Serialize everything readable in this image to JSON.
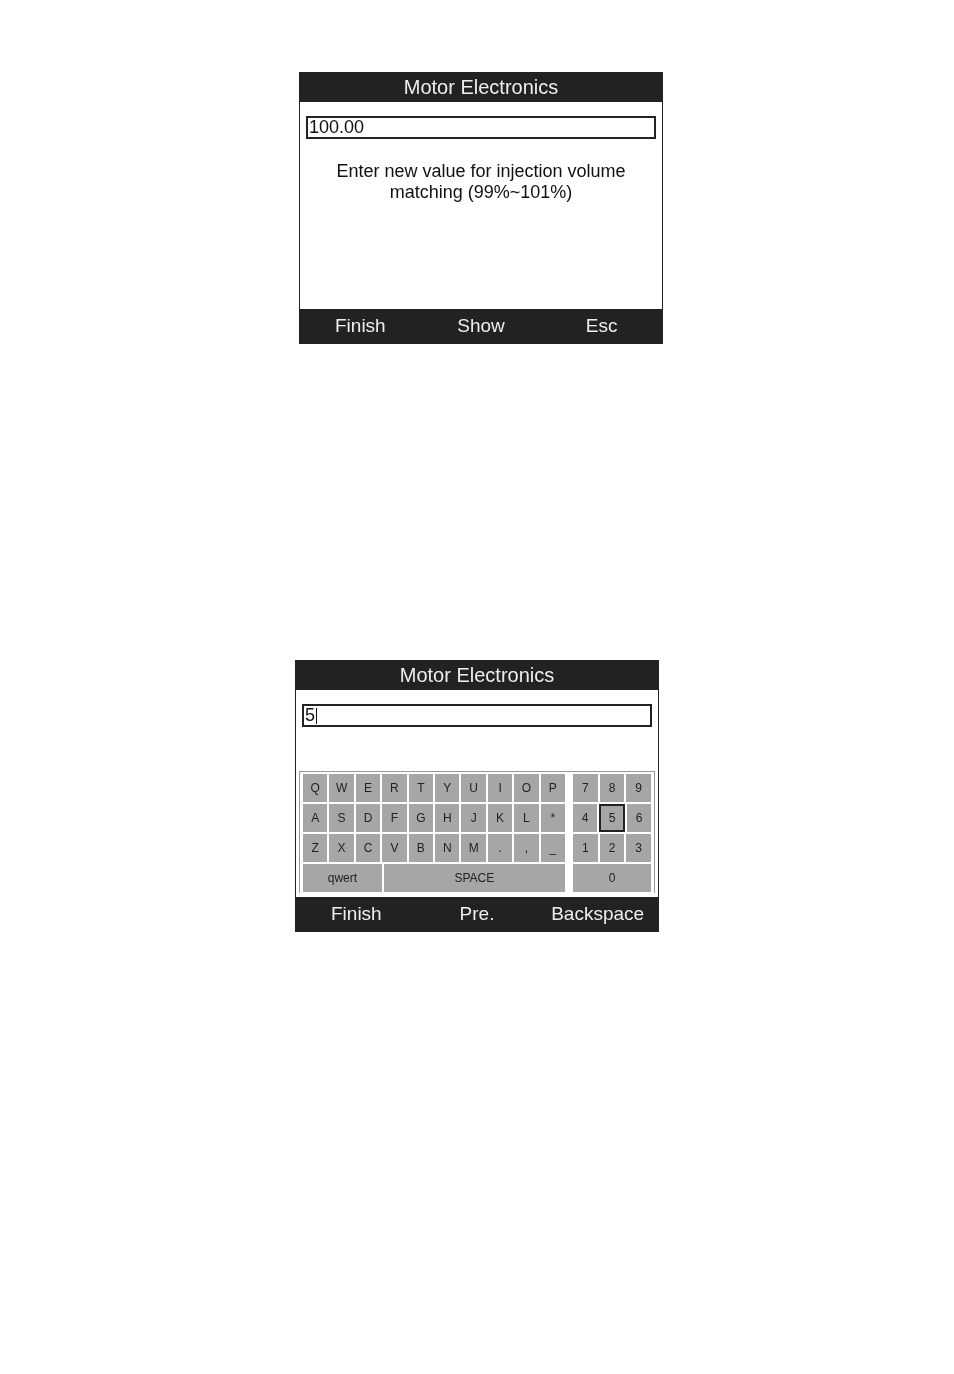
{
  "screens": [
    {
      "title": "Motor Electronics",
      "field": {
        "value": "100.00",
        "cursor": false
      },
      "message": "Enter new value for injection volume matching (99%~101%)",
      "softkeys": [
        "Finish",
        "Show",
        "Esc"
      ]
    },
    {
      "title": "Motor Electronics",
      "field": {
        "value": "5",
        "cursor": true
      },
      "keyboard": {
        "letters": [
          [
            {
              "label": "Q",
              "selected": false
            },
            {
              "label": "W",
              "selected": false
            },
            {
              "label": "E",
              "selected": false
            },
            {
              "label": "R",
              "selected": false
            },
            {
              "label": "T",
              "selected": false
            },
            {
              "label": "Y",
              "selected": false
            },
            {
              "label": "U",
              "selected": false
            },
            {
              "label": "I",
              "selected": false
            },
            {
              "label": "O",
              "selected": false
            },
            {
              "label": "P",
              "selected": false
            }
          ],
          [
            {
              "label": "A",
              "selected": false
            },
            {
              "label": "S",
              "selected": false
            },
            {
              "label": "D",
              "selected": false
            },
            {
              "label": "F",
              "selected": false
            },
            {
              "label": "G",
              "selected": false
            },
            {
              "label": "H",
              "selected": false
            },
            {
              "label": "J",
              "selected": false
            },
            {
              "label": "K",
              "selected": false
            },
            {
              "label": "L",
              "selected": false
            },
            {
              "label": "*",
              "selected": false
            }
          ],
          [
            {
              "label": "Z",
              "selected": false
            },
            {
              "label": "X",
              "selected": false
            },
            {
              "label": "C",
              "selected": false
            },
            {
              "label": "V",
              "selected": false
            },
            {
              "label": "B",
              "selected": false
            },
            {
              "label": "N",
              "selected": false
            },
            {
              "label": "M",
              "selected": false
            },
            {
              "label": ".",
              "selected": false
            },
            {
              "label": ",",
              "selected": false
            },
            {
              "label": "_",
              "selected": false
            }
          ],
          [
            {
              "label": "qwert",
              "kind": "mode",
              "selected": false
            },
            {
              "label": "SPACE",
              "kind": "space",
              "selected": false
            }
          ]
        ],
        "numpad": [
          [
            {
              "label": "7",
              "selected": false
            },
            {
              "label": "8",
              "selected": false
            },
            {
              "label": "9",
              "selected": false
            }
          ],
          [
            {
              "label": "4",
              "selected": false
            },
            {
              "label": "5",
              "selected": true
            },
            {
              "label": "6",
              "selected": false
            }
          ],
          [
            {
              "label": "1",
              "selected": false
            },
            {
              "label": "2",
              "selected": false
            },
            {
              "label": "3",
              "selected": false
            }
          ],
          [
            {
              "label": "0",
              "selected": false
            }
          ]
        ]
      },
      "softkeys": [
        "Finish",
        "Pre.",
        "Backspace"
      ]
    }
  ]
}
